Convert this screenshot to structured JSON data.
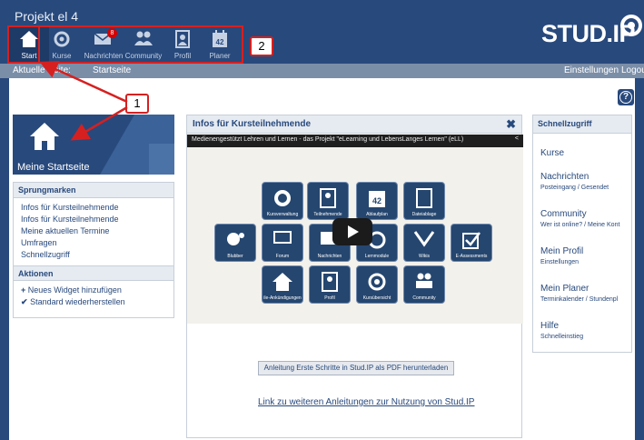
{
  "site": {
    "title": "Projekt el 4",
    "logo": "STUD.IP"
  },
  "nav": [
    {
      "label": "Start",
      "icon": "home-icon",
      "active": true
    },
    {
      "label": "Kurse",
      "icon": "courses-icon"
    },
    {
      "label": "Nachrichten",
      "icon": "mail-icon",
      "badge": "8"
    },
    {
      "label": "Community",
      "icon": "community-icon"
    },
    {
      "label": "Profil",
      "icon": "profile-icon"
    },
    {
      "label": "Planer",
      "icon": "calendar-icon"
    }
  ],
  "subbar": {
    "current_label": "Aktuelle Seite:",
    "current_page": "Startseite",
    "settings": "Einstellungen",
    "logout": "Logou"
  },
  "annotations": {
    "one": "1",
    "two": "2"
  },
  "left": {
    "tile_title": "Meine Startseite",
    "jump": {
      "title": "Sprungmarken",
      "items": [
        "Infos für Kursteilnehmende",
        "Infos für Kursteilnehmende",
        "Meine aktuellen Termine",
        "Umfragen",
        "Schnellzugriff"
      ]
    },
    "actions": {
      "title": "Aktionen",
      "add": "Neues Widget hinzufügen",
      "reset": "Standard wiederherstellen"
    }
  },
  "infos": {
    "title": "Infos für Kursteilnehmende",
    "video_title": "Medienengestützt Lehren und Lernen - das Projekt \"eLearning und LebensLanges Lernen\" (eLL)",
    "tiles": [
      "Kursverwaltung",
      "Teilnehmende",
      "Ablaufplan",
      "Dateiablage",
      "Blubber",
      "Forum",
      "Nachrichten",
      "Lernmodule",
      "Wikis",
      "E-Assessments",
      "ile-Ankündigungen",
      "Profil",
      "Kursübersicht",
      "Community"
    ],
    "pdf_button": "Anleitung Erste Schritte in Stud.IP als PDF herunterladen",
    "more_link": "Link zu weiteren Anleitungen zur Nutzung von Stud.IP"
  },
  "quick": {
    "title": "Schnellzugriff",
    "items": [
      {
        "title": "Kurse",
        "sub": ""
      },
      {
        "title": "Nachrichten",
        "sub": "Posteingang / Gesendet"
      },
      {
        "title": "Community",
        "sub": "Wer ist online? / Meine Kont"
      },
      {
        "title": "Mein Profil",
        "sub": "Einstellungen"
      },
      {
        "title": "Mein Planer",
        "sub": "Terminkalender / Stundenpl"
      },
      {
        "title": "Hilfe",
        "sub": "Schnelleinstieg"
      }
    ]
  },
  "colors": {
    "brand": "#28497c",
    "annotation": "#d62020",
    "badge": "#d60000"
  }
}
